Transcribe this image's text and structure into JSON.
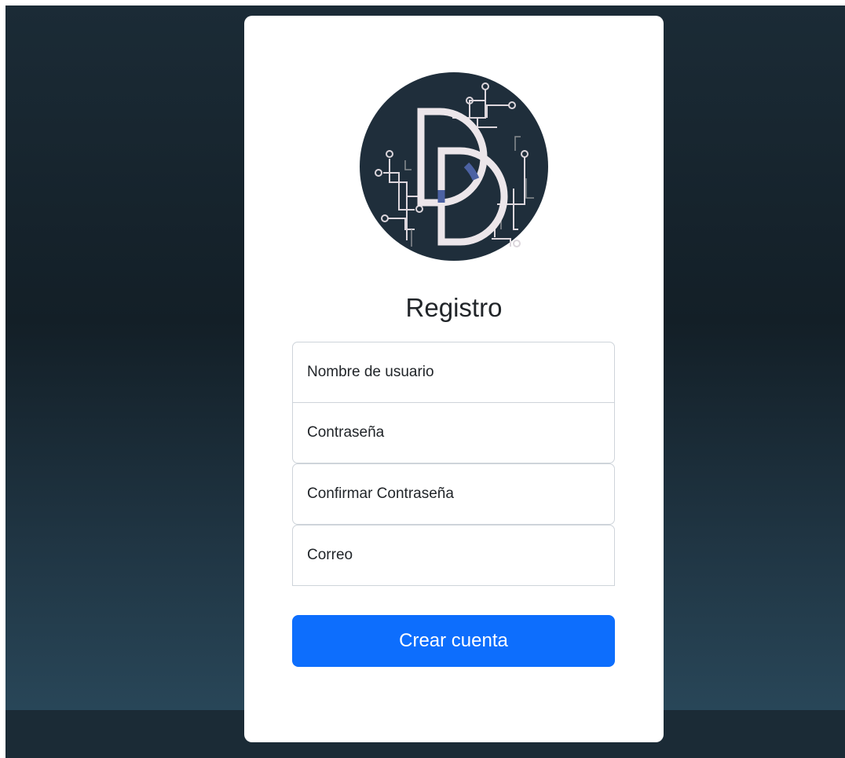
{
  "page": {
    "title": "Registro",
    "background_top": "#1b2b36",
    "background_bottom": "#2b4b5e"
  },
  "logo": {
    "letters": "DD",
    "circle_color": "#1f2e3b",
    "letter_color": "#ece6ea",
    "accent_color": "#4c62a3"
  },
  "form": {
    "username_placeholder": "Nombre de usuario",
    "password_placeholder": "Contraseña",
    "confirm_password_placeholder": "Confirmar Contraseña",
    "email_placeholder": "Correo",
    "submit_label": "Crear cuenta",
    "submit_color": "#0d6efd"
  }
}
